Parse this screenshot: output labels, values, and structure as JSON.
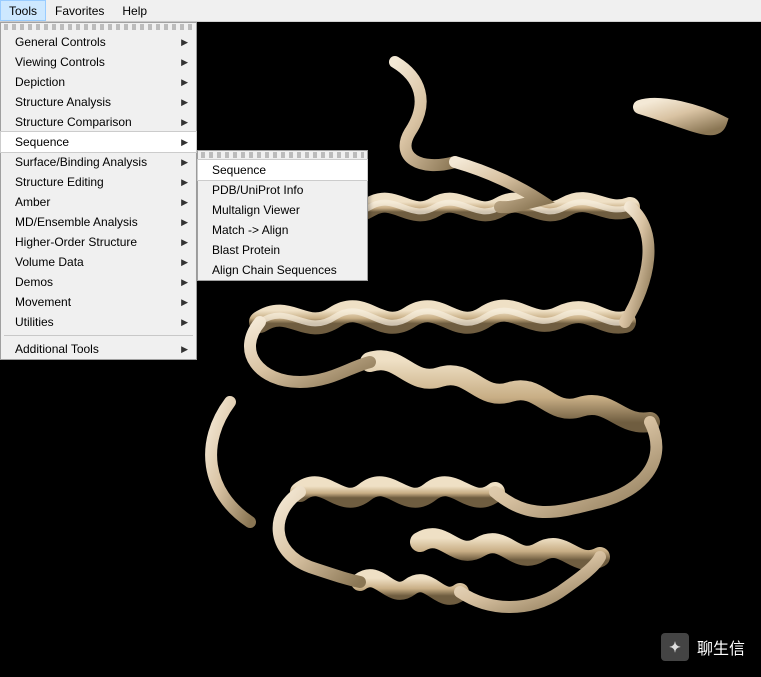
{
  "menubar": {
    "tools": "Tools",
    "favorites": "Favorites",
    "help": "Help"
  },
  "tools_menu": {
    "general_controls": "General Controls",
    "viewing_controls": "Viewing Controls",
    "depiction": "Depiction",
    "structure_analysis": "Structure Analysis",
    "structure_comparison": "Structure Comparison",
    "sequence": "Sequence",
    "surface_binding": "Surface/Binding Analysis",
    "structure_editing": "Structure Editing",
    "amber": "Amber",
    "md_ensemble": "MD/Ensemble Analysis",
    "higher_order": "Higher-Order Structure",
    "volume_data": "Volume Data",
    "demos": "Demos",
    "movement": "Movement",
    "utilities": "Utilities",
    "additional_tools": "Additional Tools"
  },
  "sequence_submenu": {
    "sequence": "Sequence",
    "pdb_uniprot": "PDB/UniProt Info",
    "multalign": "Multalign Viewer",
    "match_align": "Match -> Align",
    "blast": "Blast Protein",
    "align_chain": "Align Chain Sequences"
  },
  "watermark": {
    "text": "聊生信"
  },
  "colors": {
    "ribbon_base": "#d9c3a3",
    "ribbon_light": "#f4e9d6",
    "ribbon_dark": "#8a7654",
    "background": "#000000"
  }
}
